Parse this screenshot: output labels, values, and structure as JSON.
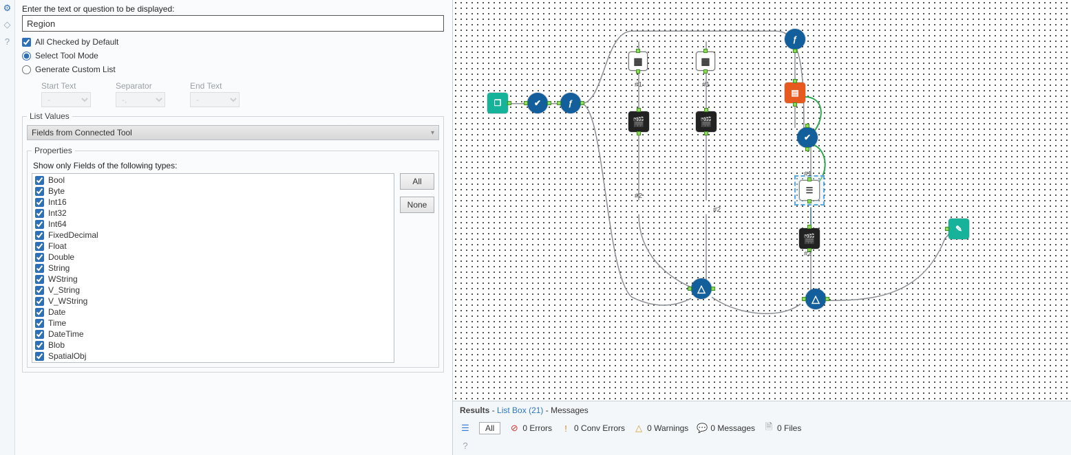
{
  "sidebar_icons": [
    "gear",
    "tag",
    "help"
  ],
  "prompt": {
    "label": "Enter the text or question to be displayed:",
    "value": "Region"
  },
  "options": {
    "all_checked_label": "All Checked by Default",
    "select_tool_label": "Select Tool Mode",
    "generate_label": "Generate Custom List"
  },
  "triplet": {
    "start_label": "Start Text",
    "sep_label": "Separator",
    "end_label": "End Text",
    "start_val": "-",
    "sep_val": "-,",
    "end_val": "-"
  },
  "list_values": {
    "legend": "List Values",
    "combo": "Fields from Connected Tool"
  },
  "properties": {
    "legend": "Properties",
    "show_only_label": "Show only Fields of the following types:",
    "all_btn": "All",
    "none_btn": "None",
    "types": [
      "Bool",
      "Byte",
      "Int16",
      "Int32",
      "Int64",
      "FixedDecimal",
      "Float",
      "Double",
      "String",
      "WString",
      "V_String",
      "V_WString",
      "Date",
      "Time",
      "DateTime",
      "Blob",
      "SpatialObj"
    ]
  },
  "results": {
    "head_label": "Results",
    "head_link": "List Box (21)",
    "head_tail": "Messages",
    "all": "All",
    "errors": "0 Errors",
    "conv": "0 Conv Errors",
    "warn": "0 Warnings",
    "msg": "0 Messages",
    "files": "0 Files"
  },
  "canvas_tags": {
    "t1": "#1",
    "t2": "#2",
    "t3": "#1",
    "t4": "#2",
    "t5": "#1",
    "t6": "#2"
  }
}
